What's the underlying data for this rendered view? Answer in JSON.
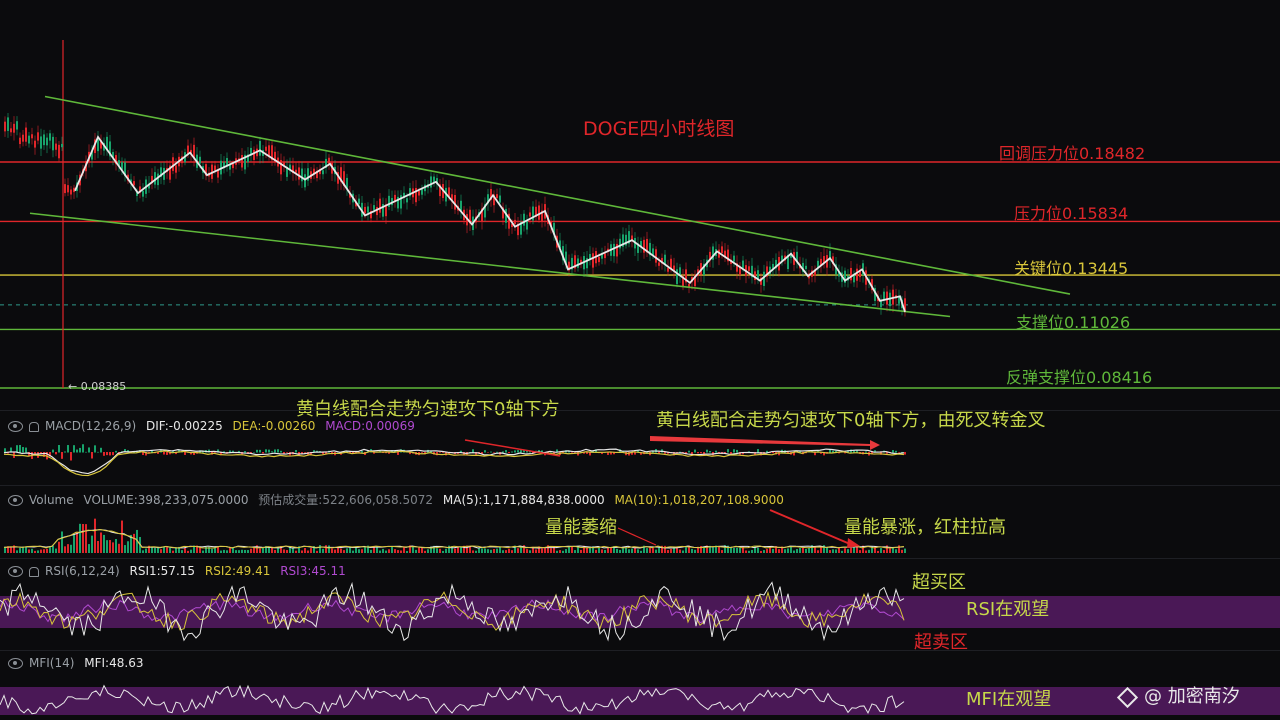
{
  "title": "DOGE四小时线图",
  "levels": {
    "callback_resistance": "回调压力位0.18482",
    "resistance": "压力位0.15834",
    "key": "关键位0.13445",
    "support": "支撑位0.11026",
    "rebound_support": "反弹支撑位0.08416"
  },
  "low_marker": "0.08385",
  "annotations": {
    "macd_left": "黄白线配合走势匀速攻下0轴下方",
    "macd_right": "黄白线配合走势匀速攻下0轴下方，由死叉转金叉",
    "volume_left": "量能萎缩",
    "volume_right": "量能暴涨，红柱拉高",
    "rsi_overbought": "超买区",
    "rsi_watch": "RSI在观望",
    "rsi_oversold": "超卖区",
    "mfi_watch": "MFI在观望"
  },
  "macd_header": {
    "name": "MACD(12,26,9)",
    "dif": "DIF:-0.00225",
    "dea": "DEA:-0.00260",
    "macd": "MACD:0.00069"
  },
  "volume_header": {
    "name": "Volume",
    "volume": "VOLUME:398,233,075.0000",
    "estimate": "预估成交量:522,606,058.5072",
    "ma5": "MA(5):1,171,884,838.0000",
    "ma10": "MA(10):1,018,207,108.9000"
  },
  "rsi_header": {
    "name": "RSI(6,12,24)",
    "rsi1": "RSI1:57.15",
    "rsi2": "RSI2:49.41",
    "rsi3": "RSI3:45.11"
  },
  "mfi_header": {
    "name": "MFI(14)",
    "mfi": "MFI:48.63"
  },
  "watermark": "@ 加密南汐",
  "colors": {
    "red": "#e0262a",
    "yellow": "#d8c53a",
    "green": "#5fb83a",
    "white": "#e8e8e8",
    "purple_band": "#4a1856"
  },
  "chart_data": {
    "type": "line",
    "title": "DOGE四小时线图",
    "price_range": [
      0.08,
      0.2
    ],
    "horizontal_levels": [
      {
        "value": 0.18482,
        "color": "#e0262a"
      },
      {
        "value": 0.15834,
        "color": "#e0262a"
      },
      {
        "value": 0.13445,
        "color": "#d8c53a"
      },
      {
        "value": 0.11026,
        "color": "#5fb83a"
      },
      {
        "value": 0.08416,
        "color": "#5fb83a"
      }
    ],
    "zigzag_wave": [
      0.172,
      0.196,
      0.171,
      0.189,
      0.179,
      0.19,
      0.177,
      0.184,
      0.161,
      0.176,
      0.157,
      0.17,
      0.156,
      0.163,
      0.137,
      0.15,
      0.131,
      0.145,
      0.132,
      0.144,
      0.134,
      0.142,
      0.132,
      0.137,
      0.123,
      0.125,
      0.118
    ],
    "trendlines": [
      {
        "name": "upper",
        "from": 0.214,
        "to": 0.126
      },
      {
        "name": "lower",
        "from": 0.162,
        "to": 0.116
      }
    ],
    "current_price_dashed": 0.1212,
    "rsi_band": [
      30,
      70
    ],
    "indicators": {
      "macd": {
        "dif": -0.00225,
        "dea": -0.0026,
        "macd": 0.00069
      },
      "volume": {
        "volume": 398233075.0,
        "estimate": 522606058.5072,
        "ma5": 1171884838.0,
        "ma10": 1018207108.9
      },
      "rsi": {
        "rsi1": 57.15,
        "rsi2": 49.41,
        "rsi3": 45.11
      },
      "mfi": {
        "mfi": 48.63
      }
    }
  }
}
